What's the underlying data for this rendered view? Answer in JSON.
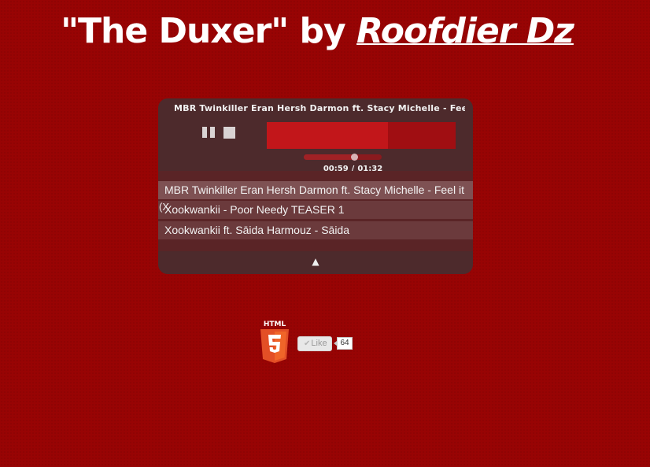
{
  "header": {
    "title_prefix": "\"The Duxer\" by",
    "author": "Roofdier Dz"
  },
  "player": {
    "now_playing": "MBR Twinkiller Eran Hersh Darmon ft. Stacy Michelle - Feel i",
    "controls": {
      "pause_icon": "pause-icon",
      "stop_icon": "stop-icon"
    },
    "visualizer_level": 0.64,
    "progress_fraction": 0.65,
    "time_current": "00:59",
    "time_separator": "/",
    "time_total": "01:32",
    "playlist": [
      {
        "label": "MBR Twinkiller Eran Hersh Darmon ft. Stacy Michelle - Feel it"
      },
      {
        "label": "Xookwankii - Poor Needy TEASER 1"
      },
      {
        "label": "Xookwankii ft. Sāida Harmouz - Sāida"
      }
    ],
    "stray_text": "(X",
    "toggle_icon": "▲"
  },
  "footer": {
    "html5_logo_text": "HTML",
    "like_label": "Like",
    "like_count": "64"
  },
  "colors": {
    "background": "#980404",
    "player": "#4d2a2c",
    "active_track": "#7e5153",
    "visualizer": "#c2161a"
  }
}
